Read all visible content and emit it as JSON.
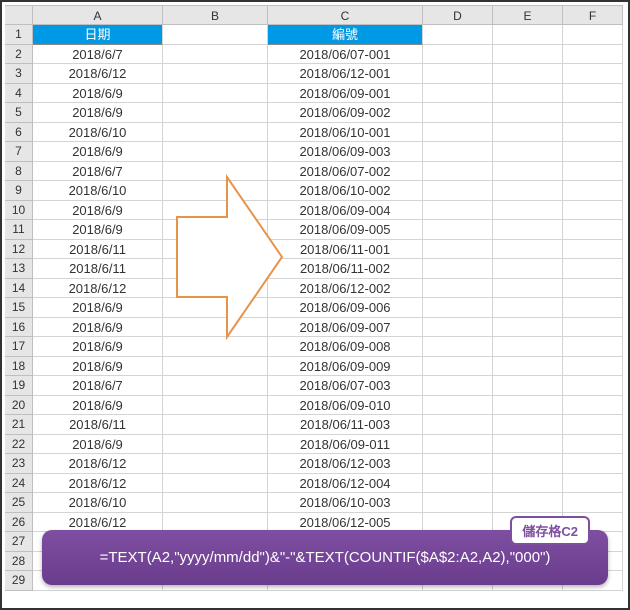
{
  "columns": [
    "A",
    "B",
    "C",
    "D",
    "E",
    "F"
  ],
  "rownums": [
    "1",
    "2",
    "3",
    "4",
    "5",
    "6",
    "7",
    "8",
    "9",
    "10",
    "11",
    "12",
    "13",
    "14",
    "15",
    "16",
    "17",
    "18",
    "19",
    "20",
    "21",
    "22",
    "23",
    "24",
    "25",
    "26",
    "27",
    "28",
    "29"
  ],
  "headers": {
    "A1": "日期",
    "C1": "編號"
  },
  "col_a": [
    "2018/6/7",
    "2018/6/12",
    "2018/6/9",
    "2018/6/9",
    "2018/6/10",
    "2018/6/9",
    "2018/6/7",
    "2018/6/10",
    "2018/6/9",
    "2018/6/9",
    "2018/6/11",
    "2018/6/11",
    "2018/6/12",
    "2018/6/9",
    "2018/6/9",
    "2018/6/9",
    "2018/6/9",
    "2018/6/7",
    "2018/6/9",
    "2018/6/11",
    "2018/6/9",
    "2018/6/12",
    "2018/6/12",
    "2018/6/10",
    "2018/6/12"
  ],
  "col_c": [
    "2018/06/07-001",
    "2018/06/12-001",
    "2018/06/09-001",
    "2018/06/09-002",
    "2018/06/10-001",
    "2018/06/09-003",
    "2018/06/07-002",
    "2018/06/10-002",
    "2018/06/09-004",
    "2018/06/09-005",
    "2018/06/11-001",
    "2018/06/11-002",
    "2018/06/12-002",
    "2018/06/09-006",
    "2018/06/09-007",
    "2018/06/09-008",
    "2018/06/09-009",
    "2018/06/07-003",
    "2018/06/09-010",
    "2018/06/11-003",
    "2018/06/09-011",
    "2018/06/12-003",
    "2018/06/12-004",
    "2018/06/10-003",
    "2018/06/12-005"
  ],
  "formula_tag": "儲存格C2",
  "formula_text": "=TEXT(A2,\"yyyy/mm/dd\")&\"-\"&TEXT(COUNTIF($A$2:A2,A2),\"000\")",
  "chart_data": {
    "type": "table",
    "title": "Excel date-based sequential numbering",
    "columns": [
      "日期",
      "編號"
    ],
    "rows": [
      [
        "2018/6/7",
        "2018/06/07-001"
      ],
      [
        "2018/6/12",
        "2018/06/12-001"
      ],
      [
        "2018/6/9",
        "2018/06/09-001"
      ],
      [
        "2018/6/9",
        "2018/06/09-002"
      ],
      [
        "2018/6/10",
        "2018/06/10-001"
      ],
      [
        "2018/6/9",
        "2018/06/09-003"
      ],
      [
        "2018/6/7",
        "2018/06/07-002"
      ],
      [
        "2018/6/10",
        "2018/06/10-002"
      ],
      [
        "2018/6/9",
        "2018/06/09-004"
      ],
      [
        "2018/6/9",
        "2018/06/09-005"
      ],
      [
        "2018/6/11",
        "2018/06/11-001"
      ],
      [
        "2018/6/11",
        "2018/06/11-002"
      ],
      [
        "2018/6/12",
        "2018/06/12-002"
      ],
      [
        "2018/6/9",
        "2018/06/09-006"
      ],
      [
        "2018/6/9",
        "2018/06/09-007"
      ],
      [
        "2018/6/9",
        "2018/06/09-008"
      ],
      [
        "2018/6/9",
        "2018/06/09-009"
      ],
      [
        "2018/6/7",
        "2018/06/07-003"
      ],
      [
        "2018/6/9",
        "2018/06/09-010"
      ],
      [
        "2018/6/11",
        "2018/06/11-003"
      ],
      [
        "2018/6/9",
        "2018/06/09-011"
      ],
      [
        "2018/6/12",
        "2018/06/12-003"
      ],
      [
        "2018/6/12",
        "2018/06/12-004"
      ],
      [
        "2018/6/10",
        "2018/06/10-003"
      ],
      [
        "2018/6/12",
        "2018/06/12-005"
      ]
    ],
    "formula_cell": "C2",
    "formula": "=TEXT(A2,\"yyyy/mm/dd\")&\"-\"&TEXT(COUNTIF($A$2:A2,A2),\"000\")"
  }
}
